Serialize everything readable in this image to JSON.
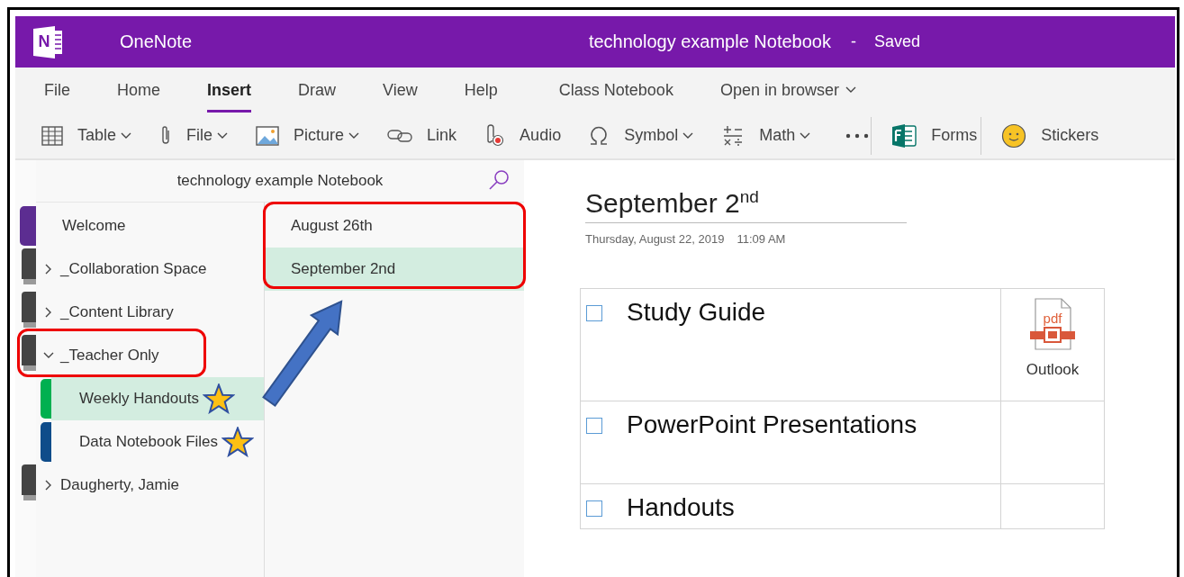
{
  "app": {
    "logo_letter": "N",
    "name": "OneNote",
    "notebook_title": "technology example Notebook",
    "separator": "-",
    "save_status": "Saved"
  },
  "menu_tabs": [
    {
      "label": "File",
      "selected": false,
      "dropdown": false
    },
    {
      "label": "Home",
      "selected": false,
      "dropdown": false
    },
    {
      "label": "Insert",
      "selected": true,
      "dropdown": false
    },
    {
      "label": "Draw",
      "selected": false,
      "dropdown": false
    },
    {
      "label": "View",
      "selected": false,
      "dropdown": false
    },
    {
      "label": "Help",
      "selected": false,
      "dropdown": false
    },
    {
      "label": "Class Notebook",
      "selected": false,
      "dropdown": false
    },
    {
      "label": "Open in browser",
      "selected": false,
      "dropdown": true
    }
  ],
  "toolbar": [
    {
      "kind": "table",
      "label": "Table",
      "dropdown": true,
      "separator_before": false
    },
    {
      "kind": "attach",
      "label": "File",
      "dropdown": true,
      "separator_before": false
    },
    {
      "kind": "picture",
      "label": "Picture",
      "dropdown": true,
      "separator_before": false
    },
    {
      "kind": "link",
      "label": "Link",
      "dropdown": false,
      "separator_before": false
    },
    {
      "kind": "audio",
      "label": "Audio",
      "dropdown": false,
      "separator_before": false
    },
    {
      "kind": "symbol",
      "label": "Symbol",
      "dropdown": true,
      "separator_before": false
    },
    {
      "kind": "math",
      "label": "Math",
      "dropdown": true,
      "separator_before": false
    },
    {
      "kind": "more"
    },
    {
      "kind": "forms",
      "label": "Forms",
      "dropdown": false,
      "separator_before": true
    },
    {
      "kind": "stickers",
      "label": "Stickers",
      "dropdown": false,
      "separator_before": true
    }
  ],
  "nav": {
    "notebook_title": "technology example Notebook",
    "sections": [
      {
        "kind": "section",
        "label": "Welcome",
        "color": "#5c2d91",
        "selected": false,
        "starred": false
      },
      {
        "kind": "group",
        "label": "_Collaboration Space",
        "expanded": false,
        "highlighted": false,
        "selected": false
      },
      {
        "kind": "group",
        "label": "_Content Library",
        "expanded": false,
        "highlighted": false,
        "selected": false
      },
      {
        "kind": "group",
        "label": "_Teacher Only",
        "expanded": true,
        "highlighted": true,
        "selected": false,
        "children": [
          {
            "kind": "section",
            "label": "Weekly Handouts",
            "color": "#00b050",
            "selected": true,
            "starred": true
          },
          {
            "kind": "section",
            "label": "Data Notebook Files",
            "color": "#0f4c8a",
            "selected": false,
            "starred": true
          }
        ]
      },
      {
        "kind": "group",
        "label": "Daugherty, Jamie",
        "expanded": false,
        "highlighted": false,
        "selected": false
      }
    ],
    "pages": [
      {
        "label": "August 26th",
        "selected": false
      },
      {
        "label": "September 2nd",
        "selected": true
      }
    ],
    "pages_highlighted": true,
    "arrow": true
  },
  "page": {
    "title": "September 2$^{nd}$",
    "date": "Thursday, August 22, 2019",
    "time": "11:09 AM",
    "rows": [
      {
        "task": "Study Guide",
        "checked": false,
        "attachment": {
          "kind": "pdf",
          "icon_text": "pdf",
          "label": "Outlook"
        }
      },
      {
        "task": "PowerPoint Presentations",
        "checked": false
      },
      {
        "task": "Handouts",
        "checked": false
      }
    ]
  }
}
